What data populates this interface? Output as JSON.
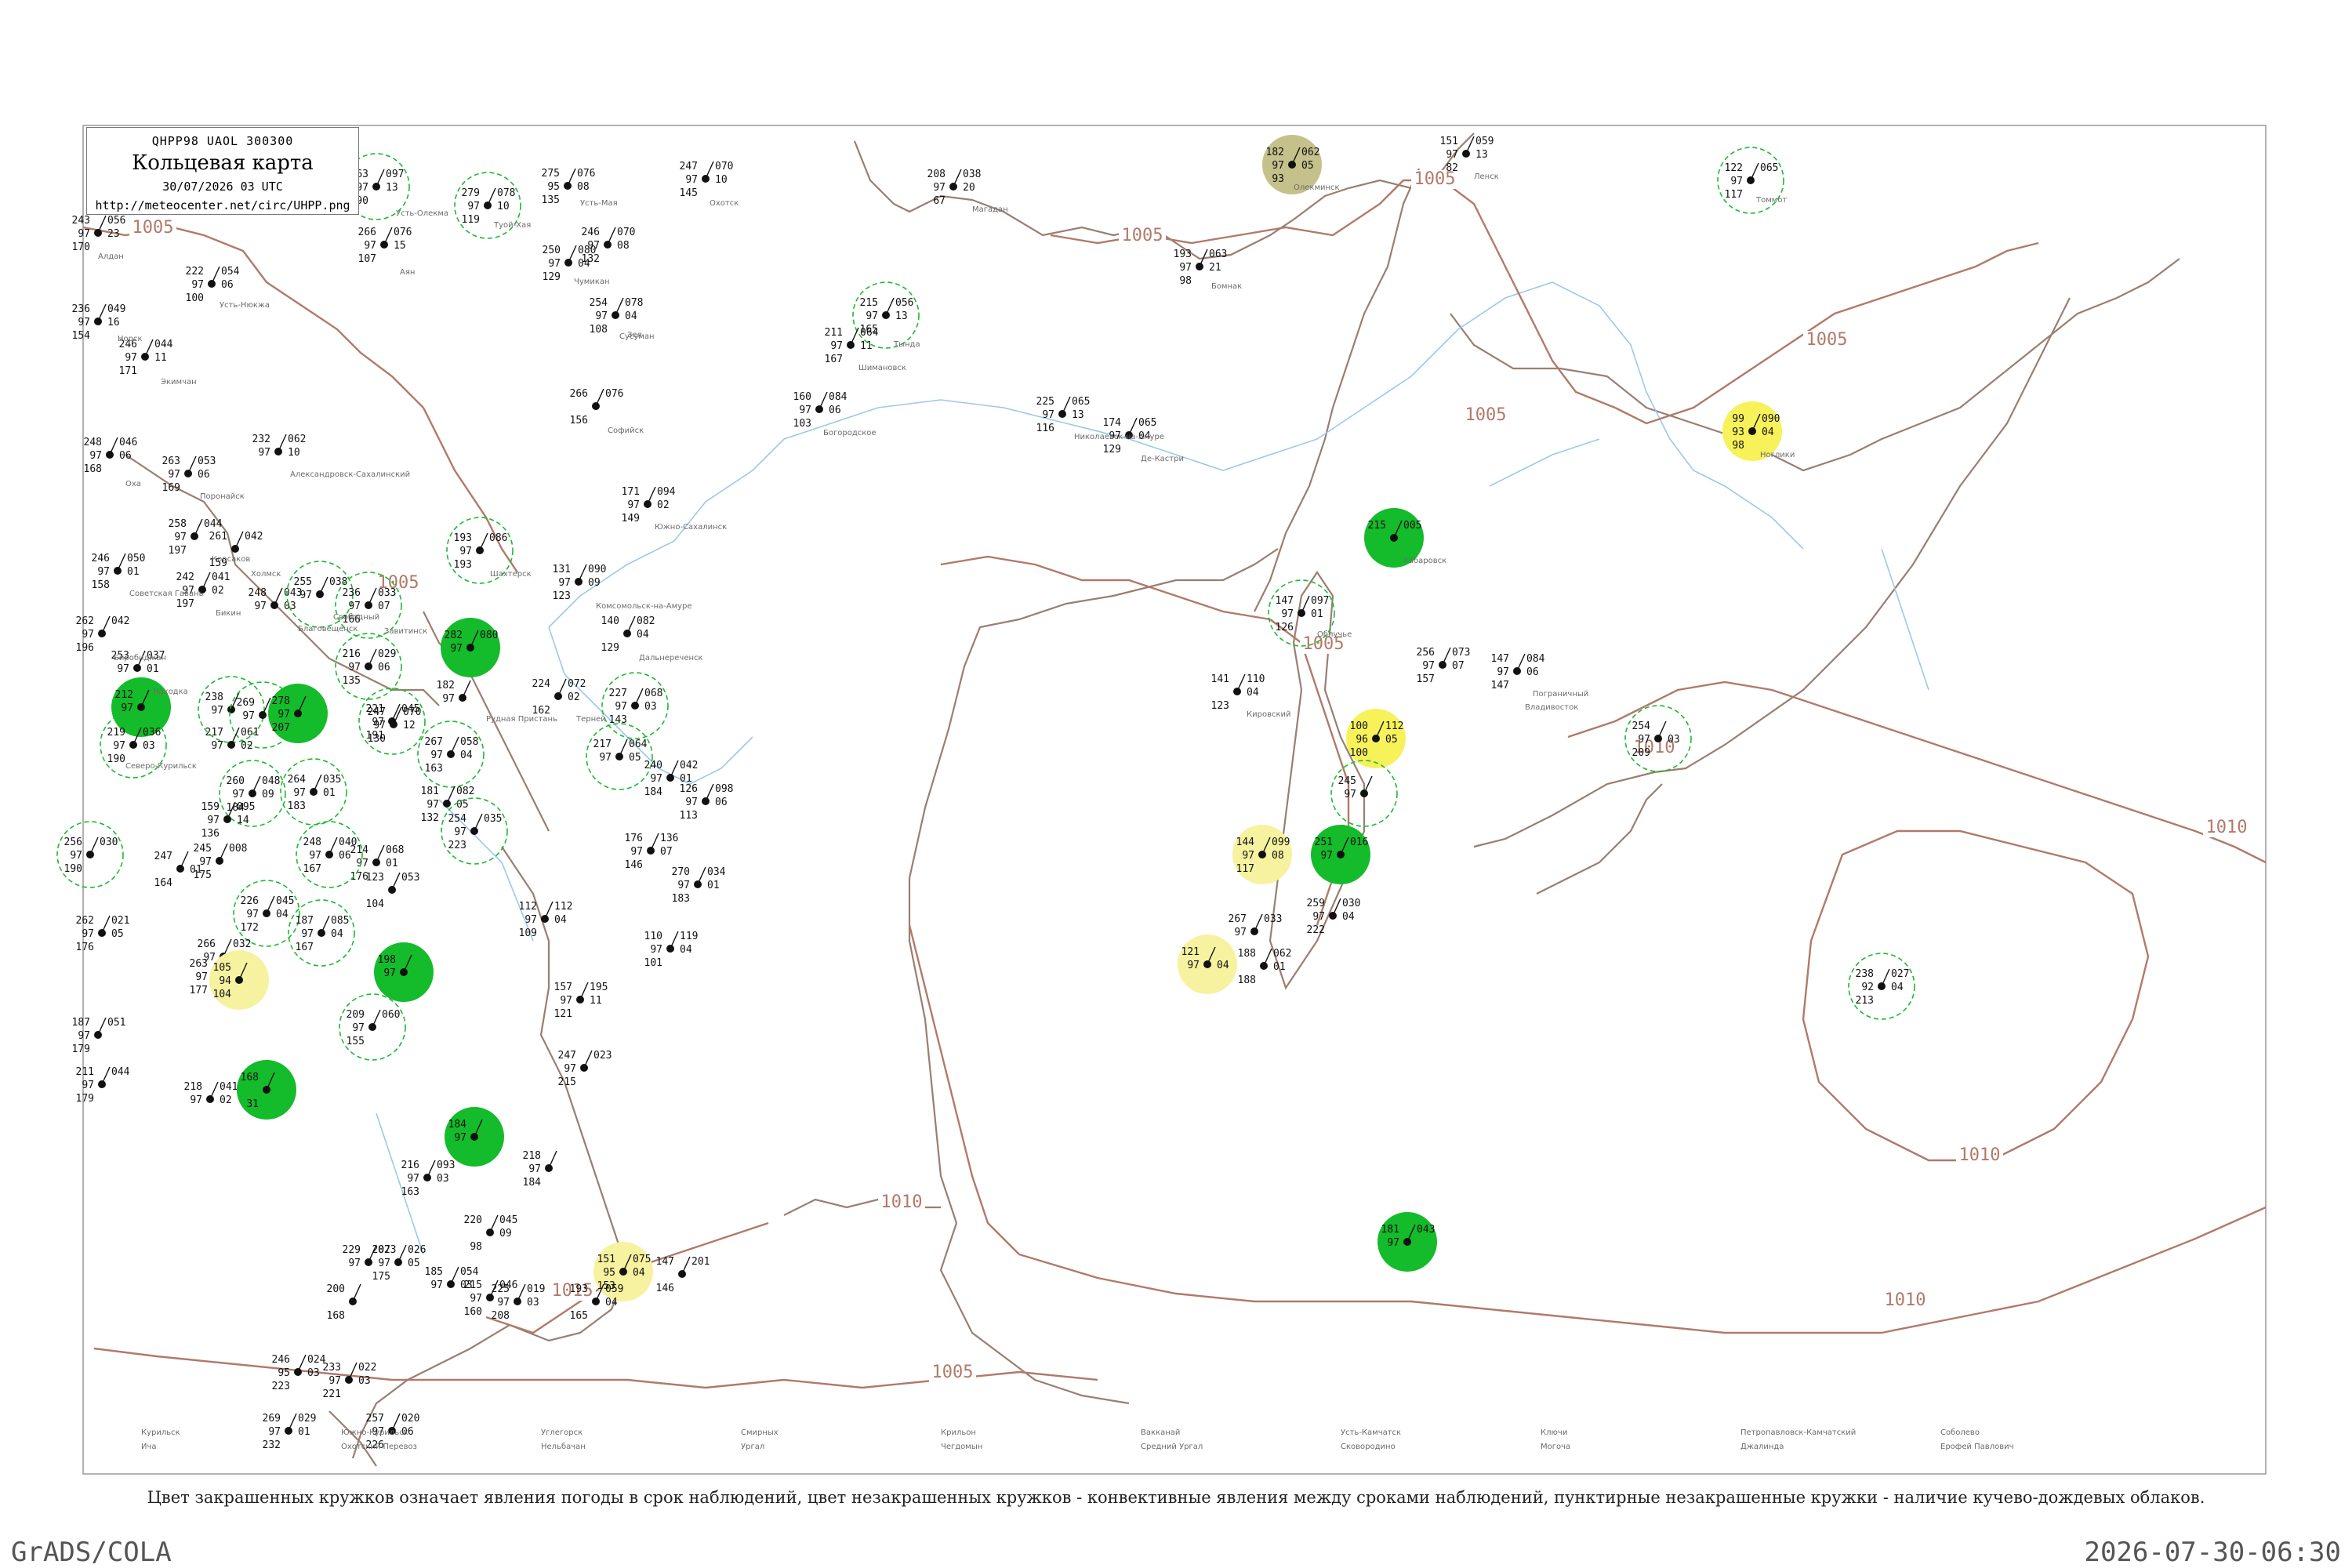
{
  "header": {
    "code": "QHPP98  UAOL  300300",
    "title": "Кольцевая карта",
    "date": "30/07/2026 03 UTC",
    "url": "http://meteocenter.net/circ/UHPP.png"
  },
  "caption": "Цвет закрашенных кружков означает явления погоды в срок наблюдений, цвет незакрашенных кружков - конвективные явления между сроками наблюдений, пунктирные незакрашенные кружки - наличие кучево-дождевых облаков.",
  "footer": {
    "left": "GrADS/COLA",
    "right": "2026-07-30-06:30"
  },
  "colors": {
    "isobar": "#b07a6a",
    "coast": "#9a7e72",
    "river": "#9cc7ef",
    "green": "#14bb2a",
    "yellow": "#f7f25a",
    "pale_yellow": "#f6f2a0",
    "olive": "#c4c18a",
    "dashed_ring": "#1eb931"
  },
  "isobars": [
    {
      "label": "1005",
      "kind": "isobar"
    },
    {
      "label": "1005",
      "kind": "isobar"
    },
    {
      "label": "1005",
      "kind": "isobar"
    },
    {
      "label": "1005",
      "kind": "isobar"
    },
    {
      "label": "1005",
      "kind": "isobar"
    },
    {
      "label": "1005",
      "kind": "isobar"
    },
    {
      "label": "1005",
      "kind": "isobar"
    },
    {
      "label": "1005",
      "kind": "isobar"
    },
    {
      "label": "1010",
      "kind": "isobar"
    },
    {
      "label": "1010",
      "kind": "isobar"
    },
    {
      "label": "1010",
      "kind": "isobar"
    },
    {
      "label": "1010",
      "kind": "isobar"
    },
    {
      "label": "1010",
      "kind": "isobar"
    },
    {
      "label": "1015",
      "kind": "isobar"
    },
    {
      "label": "1005",
      "kind": "isobar"
    }
  ],
  "stations": [
    {
      "t": "263",
      "p": "097",
      "d": "13",
      "v": "190",
      "n": "97",
      "fill": "dashed"
    },
    {
      "t": "279",
      "p": "078",
      "d": "10",
      "v": "119",
      "n": "97",
      "fill": "dashed"
    },
    {
      "t": "275",
      "p": "076",
      "d": "08",
      "v": "135",
      "n": "95",
      "fill": "none"
    },
    {
      "t": "247",
      "p": "070",
      "d": "10",
      "v": "145",
      "n": "97",
      "fill": "none"
    },
    {
      "t": "208",
      "p": "038",
      "d": "20",
      "v": "67",
      "n": "97",
      "fill": "none"
    },
    {
      "t": "182",
      "p": "062",
      "d": "05",
      "v": "93",
      "n": "97",
      "fill": "olive"
    },
    {
      "t": "151",
      "p": "059",
      "d": "13",
      "v": "82",
      "n": "97",
      "fill": "none"
    },
    {
      "t": "122",
      "p": "065",
      "d": "",
      "v": "117",
      "n": "97",
      "fill": "dashed"
    },
    {
      "t": "243",
      "p": "056",
      "d": "23",
      "v": "170",
      "n": "97",
      "fill": "none"
    },
    {
      "t": "266",
      "p": "076",
      "d": "15",
      "v": "107",
      "n": "97",
      "fill": "none"
    },
    {
      "t": "250",
      "p": "080",
      "d": "04",
      "v": "129",
      "n": "97",
      "fill": "none"
    },
    {
      "t": "246",
      "p": "070",
      "d": "08",
      "v": "132",
      "n": "97",
      "fill": "none"
    },
    {
      "t": "222",
      "p": "054",
      "d": "06",
      "v": "100",
      "n": "97",
      "fill": "none"
    },
    {
      "t": "193",
      "p": "063",
      "d": "21",
      "v": "98",
      "n": "97",
      "fill": "none"
    },
    {
      "t": "254",
      "p": "078",
      "d": "04",
      "v": "108",
      "n": "97",
      "fill": "none"
    },
    {
      "t": "215",
      "p": "056",
      "d": "13",
      "v": "165",
      "n": "97",
      "fill": "dashed"
    },
    {
      "t": "211",
      "p": "064",
      "d": "11",
      "v": "167",
      "n": "97",
      "fill": "none"
    },
    {
      "t": "236",
      "p": "049",
      "d": "16",
      "v": "154",
      "n": "97",
      "fill": "none"
    },
    {
      "t": "246",
      "p": "044",
      "d": "11",
      "v": "171",
      "n": "97",
      "fill": "none"
    },
    {
      "t": "266",
      "p": "076",
      "d": "",
      "v": "156",
      "n": "",
      "fill": "none"
    },
    {
      "t": "160",
      "p": "084",
      "d": "06",
      "v": "103",
      "n": "97",
      "fill": "none"
    },
    {
      "t": "225",
      "p": "065",
      "d": "13",
      "v": "116",
      "n": "97",
      "fill": "none"
    },
    {
      "t": "174",
      "p": "065",
      "d": "04",
      "v": "129",
      "n": "97",
      "fill": "none"
    },
    {
      "t": "99",
      "p": "090",
      "d": "04",
      "v": "98",
      "n": "93",
      "fill": "yellow"
    },
    {
      "t": "248",
      "p": "046",
      "d": "06",
      "v": "168",
      "n": "97",
      "fill": "none"
    },
    {
      "t": "232",
      "p": "062",
      "d": "10",
      "v": "",
      "n": "97",
      "fill": "none"
    },
    {
      "t": "263",
      "p": "053",
      "d": "06",
      "v": "169",
      "n": "97",
      "fill": "none"
    },
    {
      "t": "171",
      "p": "094",
      "d": "02",
      "v": "149",
      "n": "97",
      "fill": "none"
    },
    {
      "t": "258",
      "p": "044",
      "d": "",
      "v": "197",
      "n": "97",
      "fill": "none"
    },
    {
      "t": "261",
      "p": "042",
      "d": "",
      "v": "159",
      "n": "",
      "fill": "none"
    },
    {
      "t": "193",
      "p": "086",
      "d": "",
      "v": "193",
      "n": "97",
      "fill": "dashed"
    },
    {
      "t": "246",
      "p": "050",
      "d": "01",
      "v": "158",
      "n": "97",
      "fill": "none"
    },
    {
      "t": "131",
      "p": "090",
      "d": "09",
      "v": "123",
      "n": "97",
      "fill": "none"
    },
    {
      "t": "215",
      "p": "005",
      "d": "",
      "v": "",
      "n": "",
      "fill": "green"
    },
    {
      "t": "242",
      "p": "041",
      "d": "02",
      "v": "197",
      "n": "97",
      "fill": "none"
    },
    {
      "t": "248",
      "p": "043",
      "d": "03",
      "v": "",
      "n": "97",
      "fill": "none"
    },
    {
      "t": "255",
      "p": "038",
      "d": "",
      "v": "",
      "n": "97",
      "fill": "dashed"
    },
    {
      "t": "236",
      "p": "033",
      "d": "07",
      "v": "166",
      "n": "97",
      "fill": "dashed"
    },
    {
      "t": "147",
      "p": "097",
      "d": "01",
      "v": "126",
      "n": "97",
      "fill": "dashed"
    },
    {
      "t": "262",
      "p": "042",
      "d": "",
      "v": "196",
      "n": "97",
      "fill": "none"
    },
    {
      "t": "140",
      "p": "082",
      "d": "04",
      "v": "129",
      "n": "",
      "fill": "none"
    },
    {
      "t": "216",
      "p": "029",
      "d": "06",
      "v": "135",
      "n": "97",
      "fill": "dashed"
    },
    {
      "t": "282",
      "p": "080",
      "d": "",
      "v": "",
      "n": "97",
      "fill": "green"
    },
    {
      "t": "256",
      "p": "073",
      "d": "07",
      "v": "157",
      "n": "97",
      "fill": "none"
    },
    {
      "t": "147",
      "p": "084",
      "d": "06",
      "v": "147",
      "n": "97",
      "fill": "none"
    },
    {
      "t": "253",
      "p": "037",
      "d": "01",
      "v": "",
      "n": "97",
      "fill": "none"
    },
    {
      "t": "182",
      "p": "",
      "d": "",
      "v": "",
      "n": "97",
      "fill": "none"
    },
    {
      "t": "141",
      "p": "110",
      "d": "04",
      "v": "123",
      "n": "",
      "fill": "none"
    },
    {
      "t": "224",
      "p": "072",
      "d": "02",
      "v": "162",
      "n": "",
      "fill": "none"
    },
    {
      "t": "227",
      "p": "068",
      "d": "03",
      "v": "143",
      "n": "97",
      "fill": "dashed"
    },
    {
      "t": "212",
      "p": "",
      "d": "",
      "v": "",
      "n": "97",
      "fill": "green"
    },
    {
      "t": "221",
      "p": "045",
      "d": "",
      "v": "191",
      "n": "97",
      "fill": "dashed"
    },
    {
      "t": "238",
      "p": "",
      "d": "",
      "v": "",
      "n": "97",
      "fill": "dashed"
    },
    {
      "t": "269",
      "p": "032",
      "d": "",
      "v": "",
      "n": "97",
      "fill": "dashed"
    },
    {
      "t": "278",
      "p": "",
      "d": "",
      "v": "207",
      "n": "97",
      "fill": "green"
    },
    {
      "t": "247",
      "p": "070",
      "d": "12",
      "v": "130",
      "n": "97",
      "fill": "none"
    },
    {
      "t": "100",
      "p": "112",
      "d": "05",
      "v": "100",
      "n": "96",
      "fill": "yellow"
    },
    {
      "t": "254",
      "p": "",
      "d": "03",
      "v": "209",
      "n": "97",
      "fill": "dashed"
    },
    {
      "t": "219",
      "p": "036",
      "d": "03",
      "v": "190",
      "n": "97",
      "fill": "dashed"
    },
    {
      "t": "217",
      "p": "061",
      "d": "02",
      "v": "",
      "n": "97",
      "fill": "none"
    },
    {
      "t": "267",
      "p": "058",
      "d": "04",
      "v": "163",
      "n": "97",
      "fill": "dashed"
    },
    {
      "t": "217",
      "p": "064",
      "d": "05",
      "v": "",
      "n": "97",
      "fill": "dashed"
    },
    {
      "t": "240",
      "p": "042",
      "d": "01",
      "v": "184",
      "n": "97",
      "fill": "none"
    },
    {
      "t": "264",
      "p": "035",
      "d": "01",
      "v": "183",
      "n": "97",
      "fill": "dashed"
    },
    {
      "t": "260",
      "p": "048",
      "d": "09",
      "v": "184",
      "n": "97",
      "fill": "dashed"
    },
    {
      "t": "181",
      "p": "082",
      "d": "05",
      "v": "132",
      "n": "97",
      "fill": "none"
    },
    {
      "t": "126",
      "p": "098",
      "d": "06",
      "v": "113",
      "n": "97",
      "fill": "none"
    },
    {
      "t": "245",
      "p": "",
      "d": "",
      "v": "",
      "n": "97",
      "fill": "dashed"
    },
    {
      "t": "159",
      "p": "095",
      "d": "14",
      "v": "136",
      "n": "97",
      "fill": "none"
    },
    {
      "t": "254",
      "p": "035",
      "d": "",
      "v": "223",
      "n": "97",
      "fill": "dashed"
    },
    {
      "t": "256",
      "p": "030",
      "d": "",
      "v": "190",
      "n": "97",
      "fill": "dashed"
    },
    {
      "t": "245",
      "p": "008",
      "d": "",
      "v": "175",
      "n": "97",
      "fill": "none"
    },
    {
      "t": "214",
      "p": "068",
      "d": "01",
      "v": "176",
      "n": "97",
      "fill": "none"
    },
    {
      "t": "176",
      "p": "136",
      "d": "07",
      "v": "146",
      "n": "97",
      "fill": "none"
    },
    {
      "t": "144",
      "p": "099",
      "d": "08",
      "v": "117",
      "n": "97",
      "fill": "pale_yellow"
    },
    {
      "t": "251",
      "p": "016",
      "d": "",
      "v": "",
      "n": "97",
      "fill": "green"
    },
    {
      "t": "247",
      "p": "",
      "d": "01",
      "v": "164",
      "n": "",
      "fill": "none"
    },
    {
      "t": "248",
      "p": "040",
      "d": "06",
      "v": "167",
      "n": "97",
      "fill": "dashed"
    },
    {
      "t": "123",
      "p": "053",
      "d": "",
      "v": "104",
      "n": "",
      "fill": "none"
    },
    {
      "t": "270",
      "p": "034",
      "d": "01",
      "v": "183",
      "n": "97",
      "fill": "none"
    },
    {
      "t": "226",
      "p": "045",
      "d": "04",
      "v": "172",
      "n": "97",
      "fill": "dashed"
    },
    {
      "t": "112",
      "p": "112",
      "d": "04",
      "v": "109",
      "n": "97",
      "fill": "none"
    },
    {
      "t": "259",
      "p": "030",
      "d": "04",
      "v": "222",
      "n": "97",
      "fill": "none"
    },
    {
      "t": "262",
      "p": "021",
      "d": "05",
      "v": "176",
      "n": "97",
      "fill": "none"
    },
    {
      "t": "187",
      "p": "085",
      "d": "04",
      "v": "167",
      "n": "97",
      "fill": "dashed"
    },
    {
      "t": "110",
      "p": "119",
      "d": "04",
      "v": "101",
      "n": "97",
      "fill": "none"
    },
    {
      "t": "267",
      "p": "033",
      "d": "",
      "v": "",
      "n": "97",
      "fill": "none"
    },
    {
      "t": "266",
      "p": "032",
      "d": "03",
      "v": "",
      "n": "97",
      "fill": "none"
    },
    {
      "t": "263",
      "p": "036",
      "d": "05",
      "v": "177",
      "n": "97",
      "fill": "none"
    },
    {
      "t": "105",
      "p": "",
      "d": "",
      "v": "104",
      "n": "94",
      "fill": "pale_yellow"
    },
    {
      "t": "121",
      "p": "",
      "d": "04",
      "v": "",
      "n": "97",
      "fill": "pale_yellow"
    },
    {
      "t": "188",
      "p": "062",
      "d": "01",
      "v": "188",
      "n": "",
      "fill": "none"
    },
    {
      "t": "198",
      "p": "",
      "d": "",
      "v": "",
      "n": "97",
      "fill": "green"
    },
    {
      "t": "157",
      "p": "195",
      "d": "11",
      "v": "121",
      "n": "97",
      "fill": "none"
    },
    {
      "t": "238",
      "p": "027",
      "d": "04",
      "v": "213",
      "n": "92",
      "fill": "dashed"
    },
    {
      "t": "187",
      "p": "051",
      "d": "",
      "v": "179",
      "n": "97",
      "fill": "none"
    },
    {
      "t": "209",
      "p": "060",
      "d": "",
      "v": "155",
      "n": "97",
      "fill": "dashed"
    },
    {
      "t": "247",
      "p": "023",
      "d": "",
      "v": "215",
      "n": "97",
      "fill": "none"
    },
    {
      "t": "211",
      "p": "044",
      "d": "",
      "v": "179",
      "n": "97",
      "fill": "none"
    },
    {
      "t": "218",
      "p": "041",
      "d": "02",
      "v": "",
      "n": "97",
      "fill": "none"
    },
    {
      "t": "168",
      "p": "",
      "d": "",
      "v": "31",
      "n": "",
      "fill": "green"
    },
    {
      "t": "184",
      "p": "",
      "d": "",
      "v": "",
      "n": "97",
      "fill": "green"
    },
    {
      "t": "218",
      "p": "",
      "d": "",
      "v": "184",
      "n": "97",
      "fill": "none"
    },
    {
      "t": "216",
      "p": "093",
      "d": "03",
      "v": "163",
      "n": "97",
      "fill": "none"
    },
    {
      "t": "220",
      "p": "045",
      "d": "09",
      "v": "98",
      "n": "",
      "fill": "none"
    },
    {
      "t": "207",
      "p": "026",
      "d": "05",
      "v": "175",
      "n": "97",
      "fill": "none"
    },
    {
      "t": "229",
      "p": "023",
      "d": "",
      "v": "",
      "n": "97",
      "fill": "none"
    },
    {
      "t": "215",
      "p": "046",
      "d": "",
      "v": "160",
      "n": "97",
      "fill": "none"
    },
    {
      "t": "151",
      "p": "075",
      "d": "04",
      "v": "153",
      "n": "95",
      "fill": "pale_yellow"
    },
    {
      "t": "147",
      "p": "201",
      "d": "",
      "v": "146",
      "n": "",
      "fill": "none"
    },
    {
      "t": "181",
      "p": "043",
      "d": "",
      "v": "",
      "n": "97",
      "fill": "green"
    },
    {
      "t": "185",
      "p": "054",
      "d": "03",
      "v": "",
      "n": "97",
      "fill": "none"
    },
    {
      "t": "225",
      "p": "019",
      "d": "03",
      "v": "208",
      "n": "97",
      "fill": "none"
    },
    {
      "t": "200",
      "p": "",
      "d": "",
      "v": "168",
      "n": "",
      "fill": "none"
    },
    {
      "t": "193",
      "p": "059",
      "d": "04",
      "v": "165",
      "n": "",
      "fill": "none"
    },
    {
      "t": "246",
      "p": "024",
      "d": "03",
      "v": "223",
      "n": "95",
      "fill": "none"
    },
    {
      "t": "233",
      "p": "022",
      "d": "03",
      "v": "221",
      "n": "97",
      "fill": "none"
    },
    {
      "t": "269",
      "p": "029",
      "d": "01",
      "v": "232",
      "n": "97",
      "fill": "none"
    },
    {
      "t": "257",
      "p": "020",
      "d": "06",
      "v": "226",
      "n": "97",
      "fill": "none"
    }
  ],
  "place_labels": [
    "Усть-Олекма",
    "Туой-Хая",
    "Усть-Мая",
    "Охотск",
    "Магадан",
    "Олекминск",
    "Ленск",
    "Томмот",
    "Алдан",
    "Аян",
    "Чумикан",
    "Сусуман",
    "Усть-Нюкжа",
    "Бомнак",
    "Зея",
    "Тында",
    "Шимановск",
    "Норск",
    "Экимчан",
    "Софийск",
    "Богородское",
    "Николаевск-на-Амуре",
    "Де-Кастри",
    "Ноглики",
    "Оха",
    "Александровск-Сахалинский",
    "Поронайск",
    "Южно-Сахалинск",
    "Корсаков",
    "Холмск",
    "Шахтерск",
    "Советская Гавань",
    "Комсомольск-на-Амуре",
    "Хабаровск",
    "Бикин",
    "Благовещенск",
    "Свободный",
    "Завитинск",
    "Облучье",
    "Биробиджан",
    "Дальнереченск",
    "Пограничный",
    "Владивосток",
    "Находка",
    "Рудная Пристань",
    "Кировский",
    "Терней",
    "Северо-Курильск",
    "Курильск",
    "Южно-Курильск",
    "Углегорск",
    "Смирных",
    "Крильон",
    "Вакканай",
    "Усть-Камчатск",
    "Ключи",
    "Петропавловск-Камчатский",
    "Соболево",
    "Ича",
    "Охотский Перевоз",
    "Нельбачан",
    "Ургал",
    "Чегдомын",
    "Средний Ургал",
    "Сковородино",
    "Могоча",
    "Джалинда",
    "Ерофей Павлович"
  ]
}
